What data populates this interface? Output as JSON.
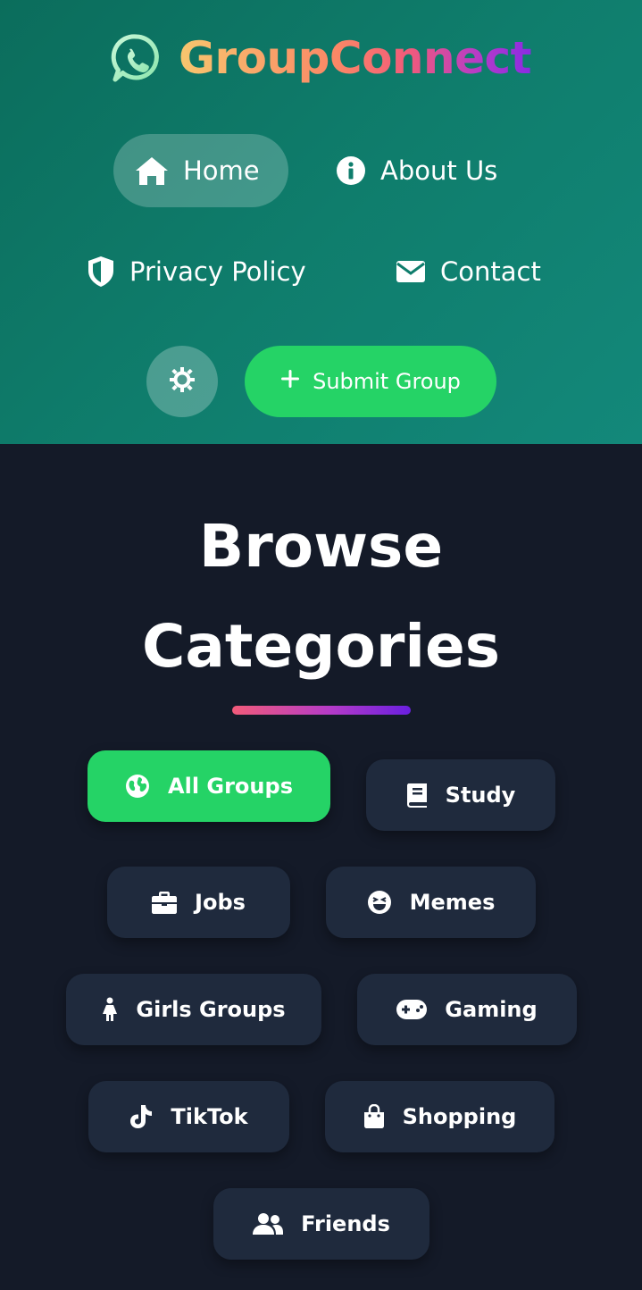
{
  "header": {
    "brand": "GroupConnect",
    "nav": [
      {
        "label": "Home",
        "icon": "home-icon",
        "active": true
      },
      {
        "label": "About Us",
        "icon": "info-icon"
      },
      {
        "label": "Privacy Policy",
        "icon": "shield-icon"
      },
      {
        "label": "Contact",
        "icon": "envelope-icon"
      }
    ],
    "theme_toggle_icon": "sun-icon",
    "submit_label": "Submit Group"
  },
  "categories": {
    "title_line1": "Browse",
    "title_line2": "Categories",
    "items": [
      {
        "label": "All Groups",
        "icon": "globe-icon",
        "active": true
      },
      {
        "label": "Study",
        "icon": "book-icon"
      },
      {
        "label": "Jobs",
        "icon": "briefcase-icon"
      },
      {
        "label": "Memes",
        "icon": "laugh-icon"
      },
      {
        "label": "Girls Groups",
        "icon": "female-icon"
      },
      {
        "label": "Gaming",
        "icon": "gamepad-icon"
      },
      {
        "label": "TikTok",
        "icon": "tiktok-icon"
      },
      {
        "label": "Shopping",
        "icon": "shopping-bag-icon"
      },
      {
        "label": "Friends",
        "icon": "users-icon"
      }
    ]
  },
  "colors": {
    "header_bg": "#0f7d6c",
    "accent_green": "#25d366",
    "page_bg": "#141a28",
    "card_bg": "#1f2a3d"
  }
}
